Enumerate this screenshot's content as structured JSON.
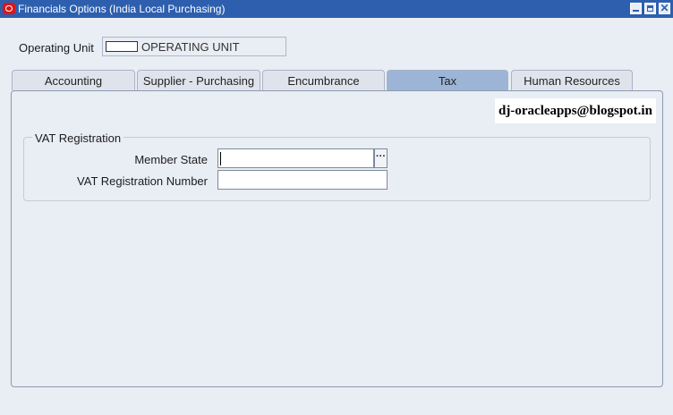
{
  "window": {
    "title": "Financials Options (India Local Purchasing)",
    "app_icon": "oracle-icon",
    "controls": [
      "minimize-icon",
      "maximize-icon",
      "close-icon"
    ]
  },
  "operating_unit": {
    "label": "Operating Unit",
    "value": "OPERATING UNIT"
  },
  "tabs": [
    {
      "label": "Accounting",
      "active": false
    },
    {
      "label": "Supplier - Purchasing",
      "active": false
    },
    {
      "label": "Encumbrance",
      "active": false
    },
    {
      "label": "Tax",
      "active": true
    },
    {
      "label": "Human Resources",
      "active": false
    }
  ],
  "watermark": "dj-oracleapps@blogspot.in",
  "vat_group": {
    "title": "VAT Registration",
    "member_state_label": "Member State",
    "member_state_value": "",
    "vat_number_label": "VAT Registration Number",
    "vat_number_value": ""
  },
  "colors": {
    "titlebar": "#2d5fae",
    "background": "#e9edf4",
    "active_tab": "#9cb5d6"
  }
}
